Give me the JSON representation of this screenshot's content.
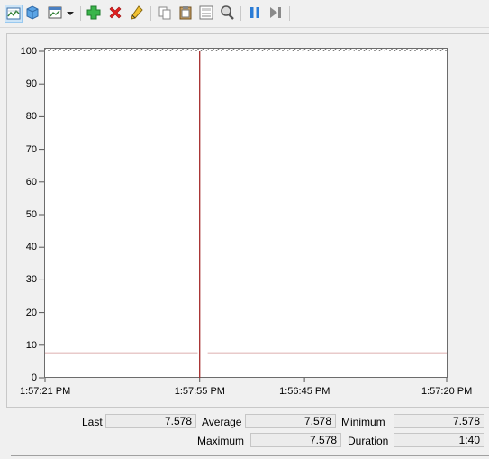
{
  "toolbar": {
    "buttons": [
      {
        "icon": "change-graph-type-icon"
      },
      {
        "icon": "clear-display-icon"
      },
      {
        "icon": "view-type-icon"
      },
      {
        "icon": "dropdown-arrow-icon"
      },
      {
        "icon": "add-counter-icon"
      },
      {
        "icon": "delete-counter-icon"
      },
      {
        "icon": "highlight-icon"
      },
      {
        "icon": "copy-properties-icon"
      },
      {
        "icon": "paste-counter-list-icon"
      },
      {
        "icon": "properties-icon"
      },
      {
        "icon": "zoom-icon"
      },
      {
        "icon": "freeze-display-icon"
      },
      {
        "icon": "update-data-icon"
      }
    ]
  },
  "chart_data": {
    "type": "line",
    "y_ticks": [
      "100",
      "90",
      "80",
      "70",
      "60",
      "50",
      "40",
      "30",
      "20",
      "10",
      "0"
    ],
    "ylim": [
      0,
      100
    ],
    "x_ticks": [
      "1:57:21 PM",
      "1:57:55 PM",
      "1:56:45 PM",
      "1:57:20 PM"
    ],
    "x_tick_positions": [
      0,
      0.385,
      0.646,
      1
    ],
    "time_cursor": 0.385,
    "series": [
      {
        "color": "#a52a2a",
        "segments": [
          {
            "x": [
              0,
              0.38
            ],
            "y": [
              7.578,
              7.578
            ]
          },
          {
            "x": [
              0.405,
              1
            ],
            "y": [
              7.578,
              7.578
            ]
          }
        ]
      }
    ],
    "grid": false,
    "colors": {
      "series": "#a52a2a",
      "cursor": "#a52a2a"
    }
  },
  "stats": {
    "last_label": "Last",
    "last_value": "7.578",
    "average_label": "Average",
    "average_value": "7.578",
    "minimum_label": "Minimum",
    "minimum_value": "7.578",
    "maximum_label": "Maximum",
    "maximum_value": "7.578",
    "duration_label": "Duration",
    "duration_value": "1:40"
  }
}
